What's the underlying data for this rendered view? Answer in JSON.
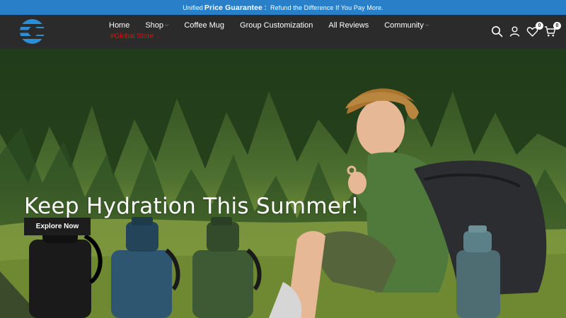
{
  "announcement": {
    "prefix": "Unified",
    "highlight": "Price Guarantee",
    "suffix": "：Refund the Difference If You Pay More."
  },
  "nav": {
    "items": [
      {
        "label": "Home",
        "has_dropdown": false
      },
      {
        "label": "Shop",
        "has_dropdown": true
      },
      {
        "label": "Coffee Mug",
        "has_dropdown": false
      },
      {
        "label": "Group Customization",
        "has_dropdown": false
      },
      {
        "label": "All Reviews",
        "has_dropdown": false
      },
      {
        "label": "Community",
        "has_dropdown": true
      }
    ],
    "global_store": "#Global Store",
    "icons": [
      "search-icon",
      "account-icon",
      "wishlist-icon",
      "cart-icon"
    ],
    "wishlist_count": "0",
    "cart_count": "0"
  },
  "hero": {
    "headline": "Keep Hydration This Summer!",
    "cta_label": "Explore Now"
  },
  "colors": {
    "announcement_bg": "#2a7fc9",
    "header_bg": "#2b2b2b",
    "global_store": "#d11111",
    "cta_bg": "#1d1d1d"
  }
}
